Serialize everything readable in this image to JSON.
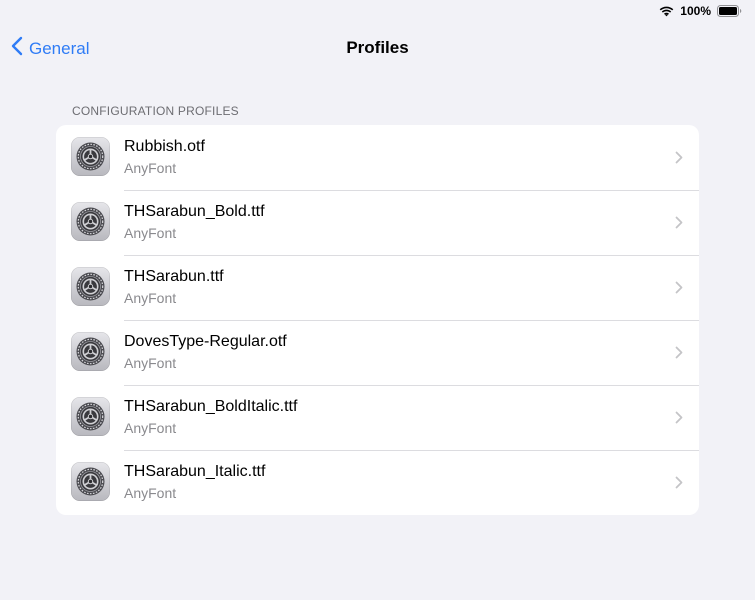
{
  "status_bar": {
    "battery_percent": "100%",
    "battery_level": 1.0,
    "icons": [
      "wifi-icon",
      "battery-icon"
    ]
  },
  "nav": {
    "back_label": "General",
    "title": "Profiles"
  },
  "section": {
    "header": "CONFIGURATION PROFILES"
  },
  "profiles": [
    {
      "name": "Rubbish.otf",
      "source": "AnyFont"
    },
    {
      "name": "THSarabun_Bold.ttf",
      "source": "AnyFont"
    },
    {
      "name": "THSarabun.ttf",
      "source": "AnyFont"
    },
    {
      "name": "DovesType-Regular.otf",
      "source": "AnyFont"
    },
    {
      "name": "THSarabun_BoldItalic.ttf",
      "source": "AnyFont"
    },
    {
      "name": "THSarabun_Italic.ttf",
      "source": "AnyFont"
    }
  ],
  "colors": {
    "accent": "#2f7cf6",
    "background": "#f2f2f7",
    "secondary_text": "#8a8a8e"
  }
}
